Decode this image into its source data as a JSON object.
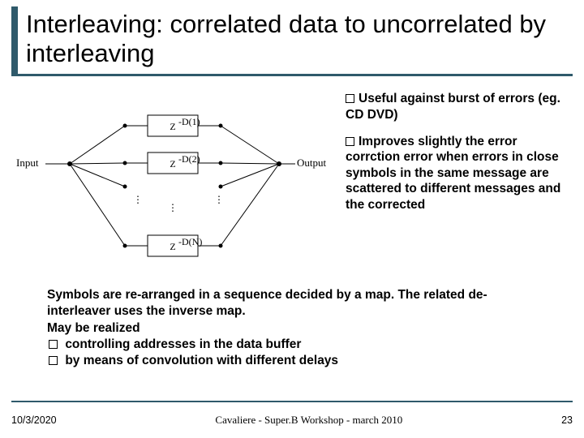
{
  "title": "Interleaving: correlated data to uncorrelated  by interleaving",
  "bullets": {
    "b1": "Useful against burst of errors (eg. CD DVD)",
    "b2": "Improves slightly the error corrction error when errors in close symbols in the same message are scattered  to different messages and the corrected"
  },
  "lower": {
    "p1": "Symbols are re-arranged in a sequence decided by a map. The related de-interleaver uses the inverse map.",
    "p2": "May be realized",
    "li1": "controlling addresses in the data buffer",
    "li2": "by means of convolution with different delays"
  },
  "diagram": {
    "input_label": "Input",
    "output_label": "Output",
    "box1": "Z⁻D(1)",
    "box2": "Z⁻D(2)",
    "boxN": "Z⁻D(N)",
    "dots": "⋮"
  },
  "footer": {
    "date": "10/3/2020",
    "center": "Cavaliere - Super.B Workshop - march 2010",
    "page": "23"
  }
}
